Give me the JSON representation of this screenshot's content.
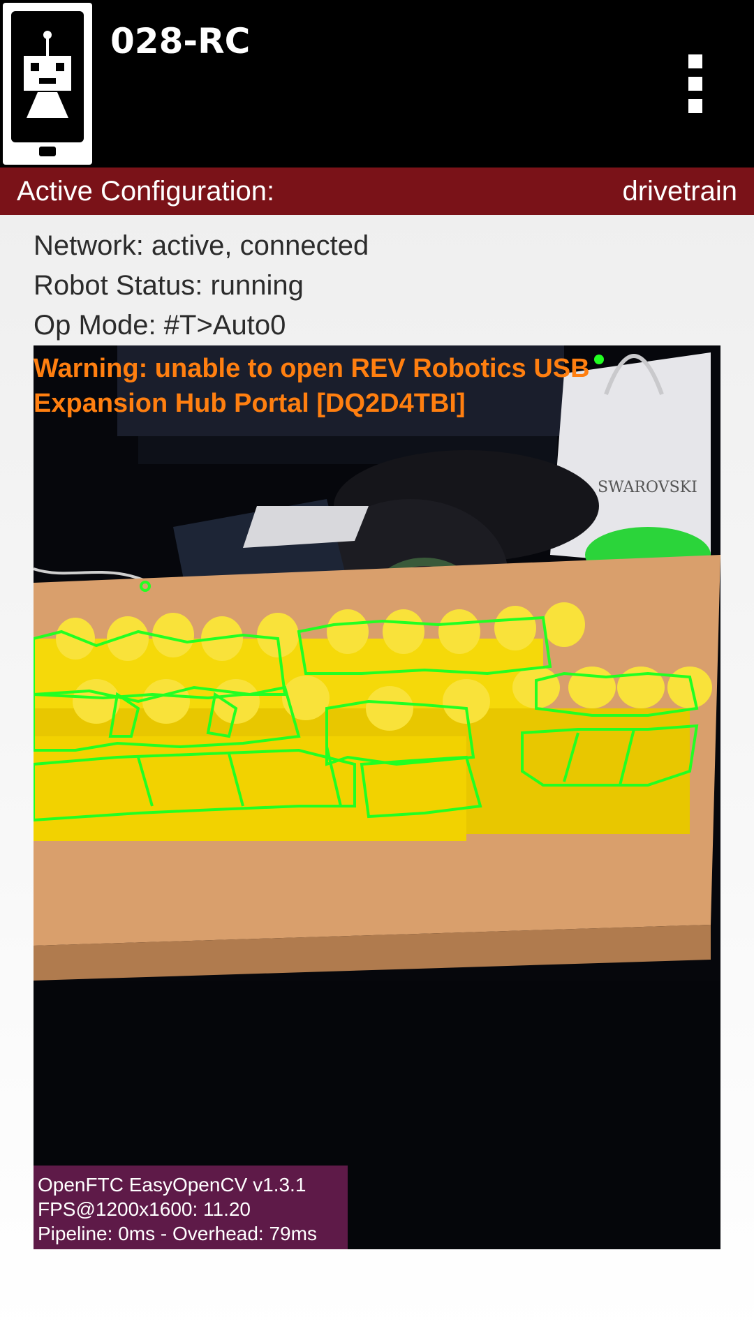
{
  "app": {
    "title": "028-RC"
  },
  "config": {
    "label": "Active Configuration:",
    "value": "drivetrain"
  },
  "status": {
    "network": "Network: active, connected",
    "robot": "Robot Status: running",
    "op_mode": "Op Mode: #T>Auto0"
  },
  "camera": {
    "warning": "Warning: unable to open REV Robotics USB Expansion Hub Portal [DQ2D4TBI]",
    "overlay": {
      "line1": "OpenFTC EasyOpenCV v1.3.1",
      "line2": "FPS@1200x1600: 11.20",
      "line3": "Pipeline: 0ms - Overhead: 79ms"
    },
    "scene_text": "SWAROVSKI"
  },
  "icons": {
    "app": "robot-phone-icon",
    "menu": "more-vert-icon"
  },
  "colors": {
    "config_bar": "#7a1218",
    "warning": "#ff7f10",
    "overlay_bg": "#5e1a48",
    "contour": "#22ff22",
    "object": "#f5d90a"
  }
}
